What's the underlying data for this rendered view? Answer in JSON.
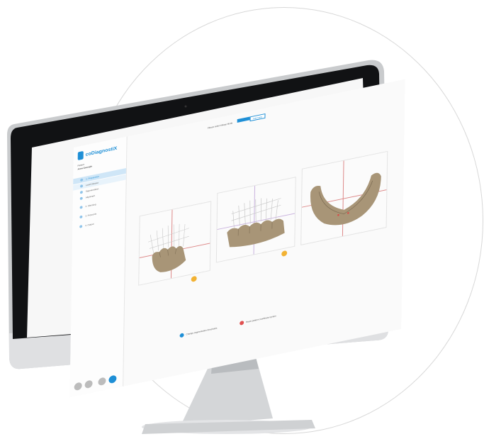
{
  "app": {
    "logo_text": "coDiagnostiX",
    "topbar": {
      "label": "Please select Merge Mode",
      "segment_left": "",
      "segment_right": "Automatic"
    },
    "sidebar": {
      "title": "Patient",
      "subtitle": "Anna Example",
      "items": [
        {
          "label": "1. Preparation"
        },
        {
          "label": "Load Dataset"
        },
        {
          "label": "Segmentation"
        },
        {
          "label": "Alignment"
        },
        {
          "label": "2. Planning"
        },
        {
          "label": "3. Protocols"
        },
        {
          "label": "4. Output"
        }
      ]
    },
    "footer": {
      "left_label": "Change segmentation thresholds",
      "right_label": "Reset patient coordinate system"
    }
  },
  "colors": {
    "accent": "#1e8fd6",
    "sidebar_active": "#cfe6f7",
    "warn": "#e05050",
    "bone": "#a89577"
  }
}
